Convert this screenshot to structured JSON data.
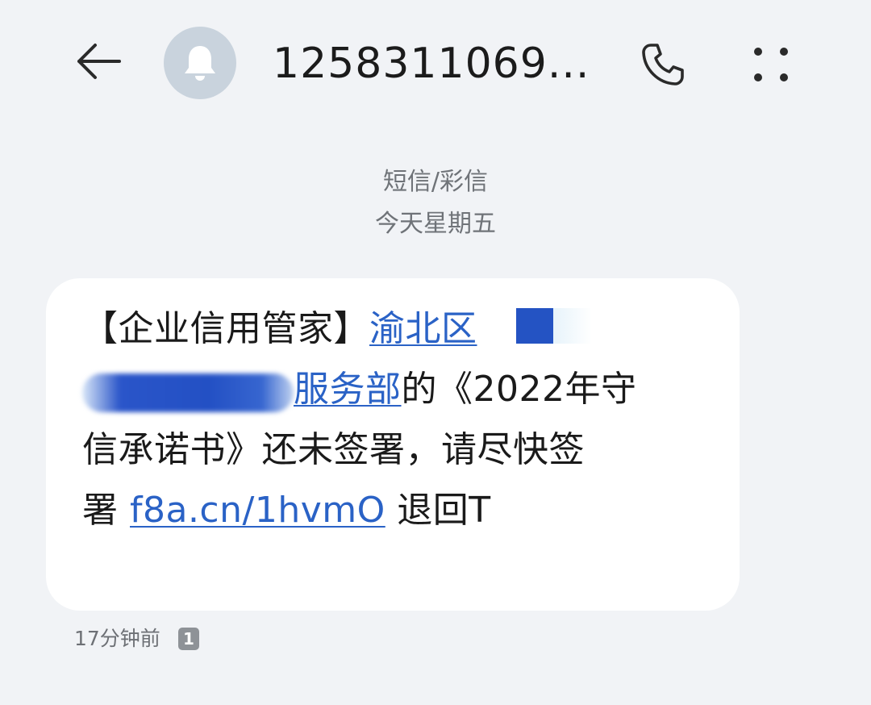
{
  "header": {
    "contact": "1258311069...",
    "icons": {
      "back": "back-arrow-icon",
      "avatar": "bell-icon",
      "call": "phone-icon",
      "more": "more-dots-icon"
    }
  },
  "conversation": {
    "type_label": "短信/彩信",
    "date_label": "今天星期五"
  },
  "message": {
    "line1_text": "【企业信用管家】",
    "line1_link": "渝北区",
    "line2_link": "服务部",
    "line2_text": "的《2022年守",
    "line3_text": "信承诺书》还未签署，请尽快签",
    "line4_prefix": "署 ",
    "line4_link": "f8a.cn/1hvmO",
    "line4_suffix": " 退回T",
    "time": "17分钟前",
    "sim": "1"
  },
  "colors": {
    "background": "#f1f3f6",
    "bubble": "#ffffff",
    "link": "#2a62c6",
    "redaction": "#2453c3",
    "meta_text": "#6f7378"
  }
}
